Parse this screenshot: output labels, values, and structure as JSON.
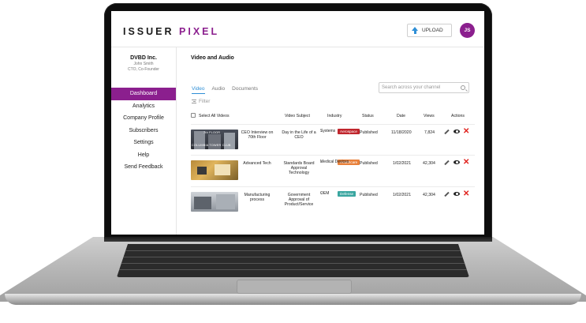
{
  "header": {
    "logo_primary": "ISSUER",
    "logo_accent": "PIXEL",
    "upload_label": "UPLOAD",
    "avatar_initials": "JS"
  },
  "company": {
    "name": "DVBD Inc.",
    "user": "John Smith",
    "role": "CTO, Co-Founder"
  },
  "sidebar": {
    "items": [
      {
        "label": "Dashboard",
        "active": true
      },
      {
        "label": "Analytics"
      },
      {
        "label": "Company Profile"
      },
      {
        "label": "Subscribers"
      },
      {
        "label": "Settings"
      },
      {
        "label": "Help"
      },
      {
        "label": "Send Feedback"
      }
    ]
  },
  "main": {
    "title": "Video and Audio",
    "tabs": [
      "Video",
      "Audio",
      "Documents"
    ],
    "search_placeholder": "Search across your channel",
    "filter_label": "Filter"
  },
  "table": {
    "columns": {
      "select": "Select All Videos",
      "subject": "Video Subject",
      "industry": "Industry",
      "status": "Status",
      "date": "Date",
      "views": "Views",
      "actions": "Actions"
    },
    "rows": [
      {
        "title": "CEO Interview on 70th Floor",
        "thumb_text_top": "7th FLOOR",
        "thumb_text_bottom": "COLUMBIA TOWER CLUB",
        "subject": "Day in the Life of a CEO",
        "industry": "Aerospace",
        "industry_color": "#c0262d",
        "industry_sub": "Systems",
        "status": "Published",
        "date": "11/18/2020",
        "views": "7,824"
      },
      {
        "title": "Advanced Tech",
        "subject": "Standards Board Approval Technology",
        "industry": "Healthcare",
        "industry_color": "#e8803a",
        "industry_sub": "Medical Devices",
        "status": "Published",
        "date": "1/02/2021",
        "views": "42,304"
      },
      {
        "title": "Manufacturing process",
        "subject": "Government Approval of Product/Service",
        "industry": "Defense",
        "industry_color": "#3aa6a0",
        "industry_sub": "OEM",
        "status": "Published",
        "date": "1/02/2021",
        "views": "42,304"
      }
    ]
  },
  "icons": [
    "upload-icon",
    "search-icon",
    "filter-icon",
    "edit-icon",
    "view-icon",
    "delete-icon"
  ]
}
